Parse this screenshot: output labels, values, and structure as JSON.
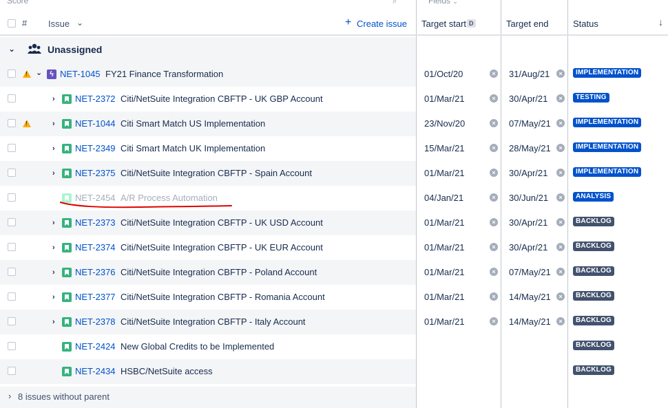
{
  "top": {
    "left_cut": "Score",
    "right_cut": "Fields"
  },
  "header": {
    "col_hash": "#",
    "col_issue": "Issue",
    "create_issue": "Create issue",
    "col_target_start": "Target start",
    "target_start_badge": "D",
    "col_target_end": "Target end",
    "col_status": "Status"
  },
  "group": {
    "label": "Unassigned"
  },
  "rows": [
    {
      "key": "NET-1045",
      "summary": "FY21 Finance Transformation",
      "start": "01/Oct/20",
      "end": "31/Aug/21",
      "status": "IMPLEMENTATION"
    },
    {
      "key": "NET-2372",
      "summary": "Citi/NetSuite Integration CBFTP - UK GBP Account",
      "start": "01/Mar/21",
      "end": "30/Apr/21",
      "status": "TESTING"
    },
    {
      "key": "NET-1044",
      "summary": "Citi Smart Match US Implementation",
      "start": "23/Nov/20",
      "end": "07/May/21",
      "status": "IMPLEMENTATION"
    },
    {
      "key": "NET-2349",
      "summary": "Citi Smart Match UK Implementation",
      "start": "15/Mar/21",
      "end": "28/May/21",
      "status": "IMPLEMENTATION"
    },
    {
      "key": "NET-2375",
      "summary": "Citi/NetSuite Integration CBFTP - Spain Account",
      "start": "01/Mar/21",
      "end": "30/Apr/21",
      "status": "IMPLEMENTATION"
    },
    {
      "key": "NET-2454",
      "summary": "A/R Process Automation",
      "start": "04/Jan/21",
      "end": "30/Jun/21",
      "status": "ANALYSIS"
    },
    {
      "key": "NET-2373",
      "summary": "Citi/NetSuite Integration CBFTP - UK USD Account",
      "start": "01/Mar/21",
      "end": "30/Apr/21",
      "status": "BACKLOG"
    },
    {
      "key": "NET-2374",
      "summary": "Citi/NetSuite Integration CBFTP - UK EUR Account",
      "start": "01/Mar/21",
      "end": "30/Apr/21",
      "status": "BACKLOG"
    },
    {
      "key": "NET-2376",
      "summary": "Citi/NetSuite Integration CBFTP - Poland Account",
      "start": "01/Mar/21",
      "end": "07/May/21",
      "status": "BACKLOG"
    },
    {
      "key": "NET-2377",
      "summary": "Citi/NetSuite Integration CBFTP - Romania Account",
      "start": "01/Mar/21",
      "end": "14/May/21",
      "status": "BACKLOG"
    },
    {
      "key": "NET-2378",
      "summary": "Citi/NetSuite Integration CBFTP - Italy Account",
      "start": "01/Mar/21",
      "end": "14/May/21",
      "status": "BACKLOG"
    },
    {
      "key": "NET-2424",
      "summary": "New Global Credits to be Implemented",
      "start": "",
      "end": "",
      "status": "BACKLOG"
    },
    {
      "key": "NET-2434",
      "summary": "HSBC/NetSuite access",
      "start": "",
      "end": "",
      "status": "BACKLOG"
    }
  ],
  "footer": {
    "text": "8 issues without parent"
  },
  "colors": {
    "link": "#0052cc",
    "story": "#36b37e",
    "epic": "#6554c0",
    "warning": "#ffab00",
    "annotation": "#e00000"
  }
}
